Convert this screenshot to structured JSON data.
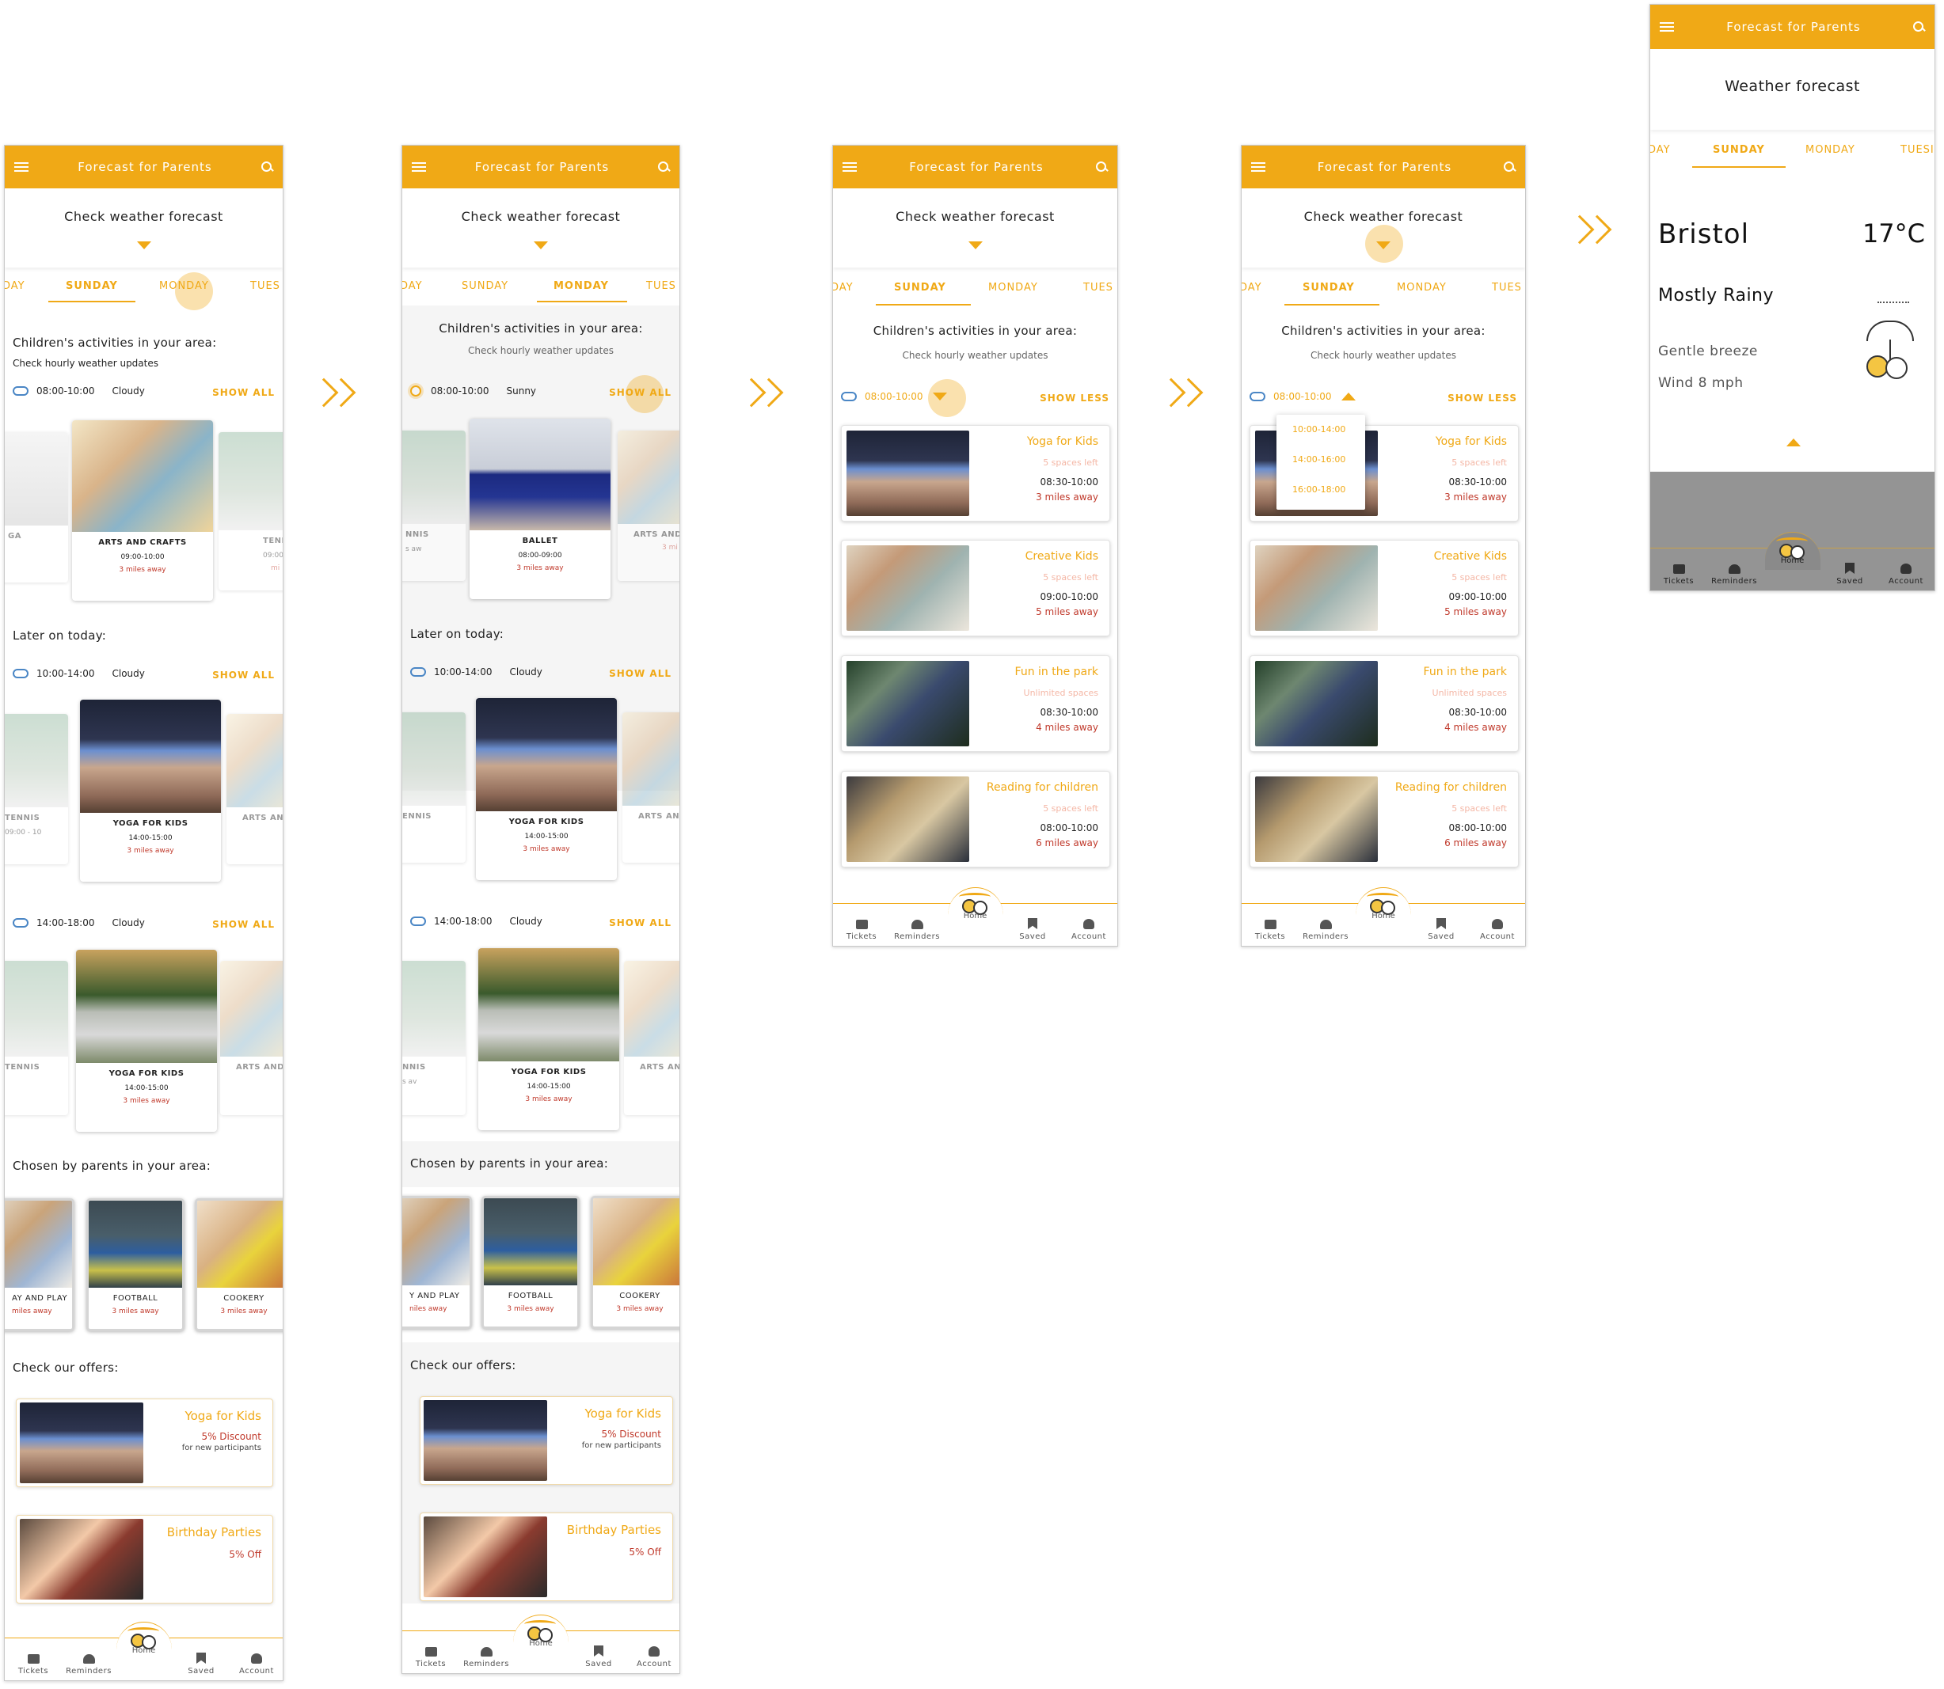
{
  "app": {
    "title": "Forecast for Parents",
    "accent_color": "#f0a916",
    "distance_color": "#c0392b",
    "check_forecast": "Check weather forecast",
    "weather_forecast": "Weather forecast"
  },
  "tabs": {
    "day_partial": "DAY",
    "sunday": "SUNDAY",
    "monday": "MONDAY",
    "tues_partial": "TUES",
    "tues_partial_wide": "TUESI"
  },
  "sections": {
    "children_activities": "Children's activities in your area:",
    "hourly": "Check hourly weather updates",
    "later_today": "Later on today:",
    "chosen": "Chosen by parents in your area:",
    "offers": "Check our offers:"
  },
  "slots": {
    "s1": {
      "time": "08:00-10:00",
      "weather": "Cloudy",
      "icon": "cloud-icon"
    },
    "s1_sunny": {
      "time": "08:00-10:00",
      "weather": "Sunny",
      "icon": "sun-icon"
    },
    "s2": {
      "time": "10:00-14:00",
      "weather": "Cloudy",
      "icon": "cloud-icon"
    },
    "s3": {
      "time": "14:00-18:00",
      "weather": "Cloudy",
      "icon": "cloud-icon"
    },
    "s_exp": {
      "time": "08:00-10:00"
    }
  },
  "actions": {
    "show_all": "SHOW ALL",
    "show_less": "SHOW LESS"
  },
  "cards": {
    "arts": {
      "title": "ARTS AND CRAFTS",
      "time": "09:00-10:00",
      "distance": "3 miles away"
    },
    "ballet": {
      "title": "BALLET",
      "time": "08:00-09:00",
      "distance": "3 miles away"
    },
    "yoga": {
      "title": "YOGA FOR KIDS",
      "time": "14:00-15:00",
      "distance": "3 miles away"
    },
    "tennis_partial": "TENNIS",
    "tennis_partial_short": "TENN",
    "tennis_clipped": "ENNIS",
    "tennis_clipped_short": "NNIS",
    "yoga_partial": "GA",
    "arts_partial": "ARTS AND C",
    "arts_partial_two": "ARTS AND CI",
    "arts_partial_three": "ARTS AND",
    "blur_time": "09:00 - 10",
    "blur_time_short": "09:00",
    "blur_dist": "3 mi",
    "blur_dist_short": "mi",
    "blur_dist_left": "s aw",
    "blur_dist_tiny": "s av"
  },
  "chosen": {
    "play": {
      "title": "AY AND PLAY",
      "distance": "miles away"
    },
    "play_short": {
      "title": "Y AND PLAY",
      "distance": "niles away"
    },
    "football": {
      "title": "FOOTBALL",
      "distance": "3 miles away"
    },
    "cookery": {
      "title": "COOKERY",
      "distance": "3 miles away"
    }
  },
  "offers": {
    "yoga": {
      "title": "Yoga for Kids",
      "discount": "5% Discount",
      "sub": "for new participants"
    },
    "birthday": {
      "title": "Birthday Parties",
      "discount": "5% Off"
    }
  },
  "list": {
    "yoga": {
      "title": "Yoga for Kids",
      "spaces": "5 spaces left",
      "time": "08:30-10:00",
      "distance": "3 miles away"
    },
    "creative": {
      "title": "Creative Kids",
      "spaces": "5 spaces left",
      "time": "09:00-10:00",
      "distance": "5 miles away"
    },
    "park": {
      "title": "Fun in the park",
      "spaces": "Unlimited spaces",
      "time": "08:30-10:00",
      "distance": "4 miles away"
    },
    "reading": {
      "title": "Reading for children",
      "spaces": "5 spaces left",
      "time": "08:00-10:00",
      "distance": "6 miles away"
    }
  },
  "dropdown": [
    "10:00-14:00",
    "14:00-16:00",
    "16:00-18:00"
  ],
  "weather": {
    "city": "Bristol",
    "temp": "17°C",
    "condition": "Mostly Rainy",
    "breeze": "Gentle breeze",
    "wind": "Wind 8 mph"
  },
  "nav": {
    "tickets": "Tickets",
    "reminders": "Reminders",
    "home": "Home",
    "saved": "Saved",
    "account": "Account"
  }
}
